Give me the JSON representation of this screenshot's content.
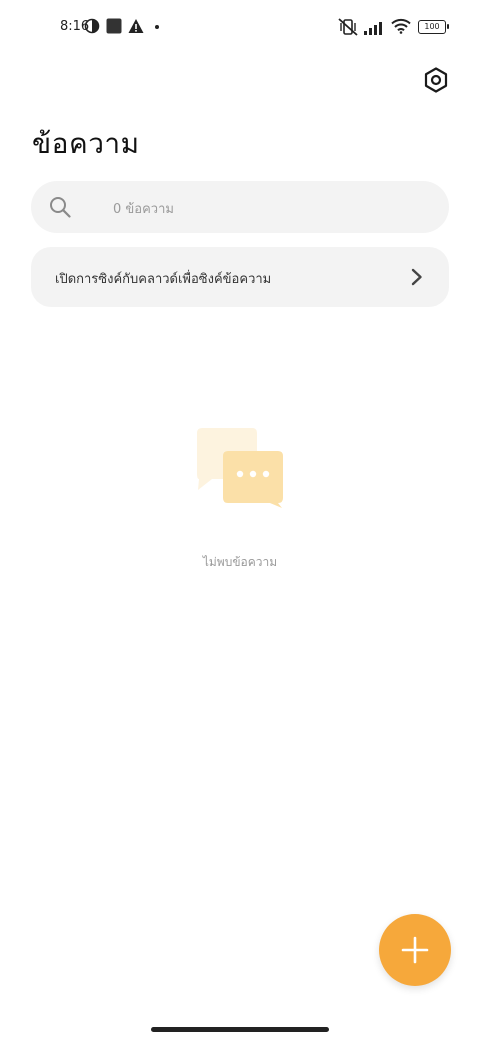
{
  "status_bar": {
    "time": "8:16",
    "battery": "100",
    "icons": [
      "data-saver-icon",
      "square-notification-icon",
      "warning-icon",
      "dot-icon",
      "muted-vibrate-icon",
      "signal-icon",
      "wifi-icon",
      "battery-icon"
    ]
  },
  "header": {
    "title": "ข้อความ",
    "settings_icon": "settings-hexagon-icon"
  },
  "search": {
    "placeholder": "0 ข้อความ",
    "icon": "search-icon"
  },
  "sync_banner": {
    "label": "เปิดการซิงค์กับคลาวด์เพื่อซิงค์ข้อความ",
    "icon": "chevron-right-icon"
  },
  "empty_state": {
    "text": "ไม่พบข้อความ",
    "illustration": "chat-bubbles-icon",
    "colors": {
      "back": "#fdf3df",
      "front": "#fbe0a8"
    }
  },
  "fab": {
    "icon": "plus-icon",
    "color": "#f6a83b"
  }
}
